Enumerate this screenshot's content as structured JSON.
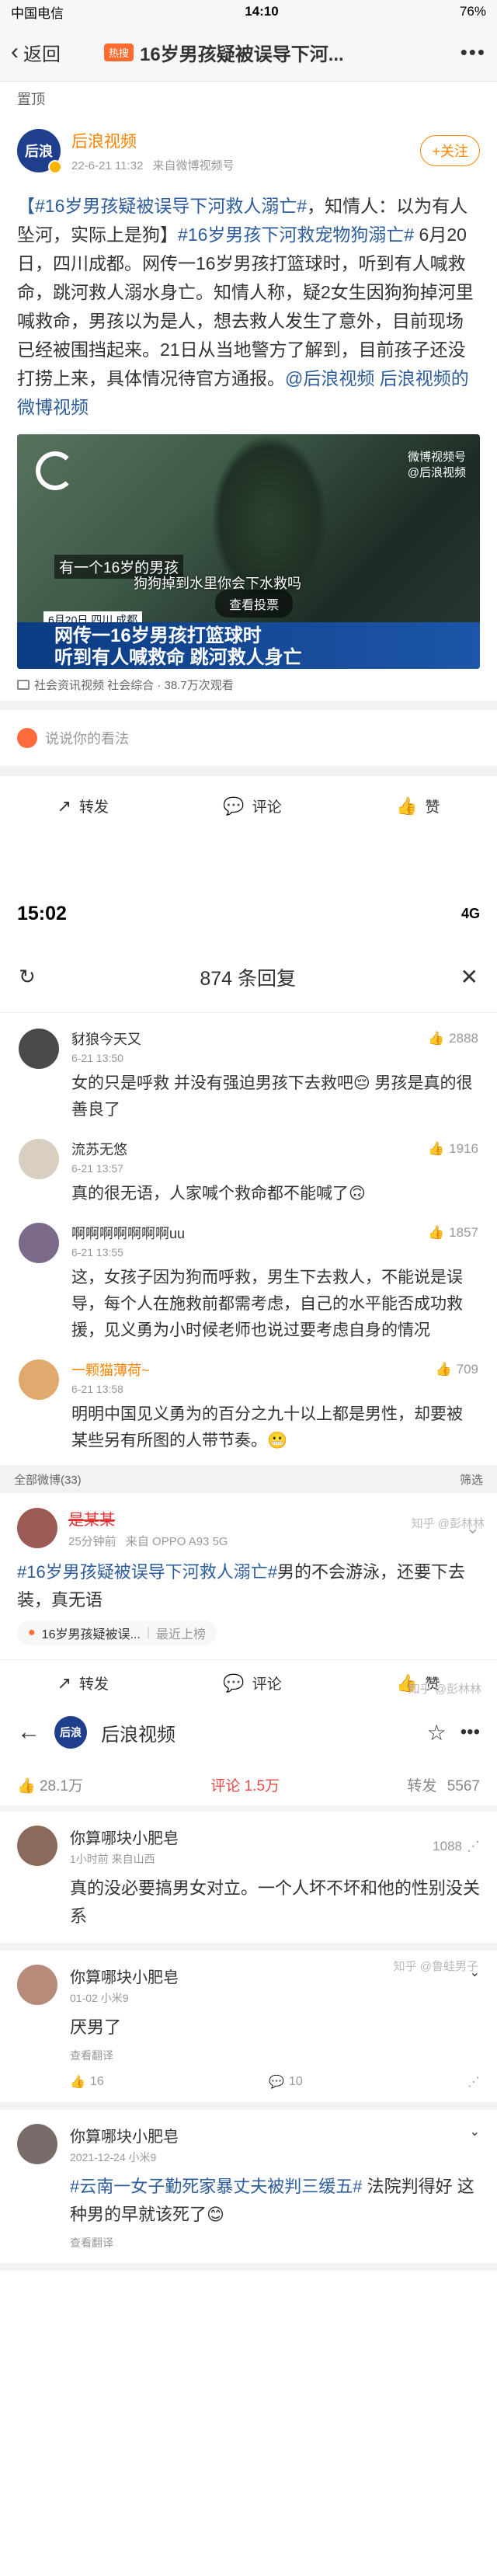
{
  "s1": {
    "status": {
      "carrier": "中国电信",
      "time": "14:10",
      "battery": "76%"
    },
    "nav": {
      "back": "返回",
      "badge": "热搜",
      "title": "16岁男孩疑被误导下河..."
    },
    "pinned": "置顶",
    "author": {
      "name": "后浪视频",
      "logo": "后浪",
      "time": "22-6-21 11:32",
      "source": "来自微博视频号",
      "follow": "+关注"
    },
    "post_segments": [
      {
        "text": "【#16岁男孩疑被误导下河救人溺亡#",
        "link": true
      },
      {
        "text": "，知情人：以为有人坠河，实际上是狗】",
        "link": false
      },
      {
        "text": "#16岁男孩下河救宠物狗溺亡#",
        "link": true
      },
      {
        "text": " 6月20日，四川成都。网传一16岁男孩打篮球时，听到有人喊救命，跳河救人溺水身亡。知情人称，疑2女生因狗狗掉河里喊救命，男孩以为是人，想去救人发生了意外，目前现场已经被围挡起来。21日从当地警方了解到，目前孩子还没打捞上来，具体情况待官方通报。",
        "link": false
      },
      {
        "text": "@后浪视频",
        "link": true
      },
      {
        "text": " ",
        "link": false
      },
      {
        "text": "后浪视频的微博视频",
        "link": true
      }
    ],
    "video": {
      "watermark": "微博视频号\n@后浪视频",
      "caption1": "有一个16岁的男孩",
      "caption2": "狗狗掉到水里你会下水救吗",
      "date": "6月20日 四川 成都",
      "vote": "查看投票",
      "banner": "网传一16岁男孩打篮球时\n听到有人喊救命 跳河救人身亡"
    },
    "meta": "社会资讯视频 社会综合 · 38.7万次观看",
    "comment_placeholder": "说说你的看法",
    "actions": {
      "forward": "转发",
      "comment": "评论",
      "like": "赞"
    }
  },
  "s2": {
    "status": {
      "time": "15:02",
      "network": "4G"
    },
    "title": "874 条回复",
    "replies": [
      {
        "name": "豺狼今天又",
        "time": "6-21 13:50",
        "likes": "2888",
        "text": "女的只是呼救 并没有强迫男孩下去救吧😔 男孩是真的很善良了",
        "avatar": "#4a4a4a"
      },
      {
        "name": "流苏无悠",
        "time": "6-21 13:57",
        "likes": "1916",
        "text": "真的很无语，人家喊个救命都不能喊了🙃",
        "avatar": "#d8cfc0"
      },
      {
        "name": "啊啊啊啊啊啊啊uu",
        "time": "6-21 13:55",
        "likes": "1857",
        "text": "这，女孩子因为狗而呼救，男生下去救人，不能说是误导，每个人在施救前都需考虑，自己的水平能否成功救援，见义勇为小时候老师也说过要考虑自身的情况",
        "avatar": "#7b6a8a"
      },
      {
        "name": "一颗猫薄荷~",
        "time": "6-21 13:58",
        "likes": "709",
        "text": "明明中国见义勇为的百分之九十以上都是男性，却要被某些另有所图的人带节奏。😬",
        "avatar": "#e0a96d",
        "name_orange": true
      }
    ],
    "watermark": "知乎 @彭林林",
    "feed_bar": {
      "left": "全部微博(33)",
      "right": "筛选"
    },
    "post": {
      "name": "是某某",
      "time": "25分钟前",
      "source": "来自 OPPO A93 5G",
      "hashtag": "#16岁男孩疑被误导下河救人溺亡#",
      "text": "男的不会游泳，还要下去装，真无语",
      "chip_title": "16岁男孩疑被误...",
      "chip_rank": "最近上榜"
    },
    "actions": {
      "forward": "转发",
      "comment": "评论",
      "like": "赞"
    },
    "watermark2": "知乎 @彭林林"
  },
  "s3": {
    "title": "后浪视频",
    "logo": "后浪",
    "stats": {
      "likes": "28.1万",
      "comments_label": "评论",
      "comments": "1.5万",
      "forward_label": "转发",
      "forward": "5567"
    },
    "replies": [
      {
        "name": "你算哪块小肥皂",
        "meta": "1小时前  来自山西",
        "likes": "1088",
        "text": "真的没必要搞男女对立。一个人坏不坏和他的性别没关系",
        "tools": null
      },
      {
        "name": "你算哪块小肥皂",
        "meta": "01-02  小米9",
        "text": "厌男了",
        "tag": "查看翻译",
        "tools": {
          "like": "16",
          "comment": "10"
        }
      },
      {
        "name": "你算哪块小肥皂",
        "meta": "2021-12-24  小米9",
        "hashtag": "#云南一女子勤死家暴丈夫被判三缓五#",
        "text": " 法院判得好 这种男的早就该死了😊",
        "tag": "查看翻译"
      }
    ],
    "watermark": "知乎 @鲁蛙男子"
  }
}
